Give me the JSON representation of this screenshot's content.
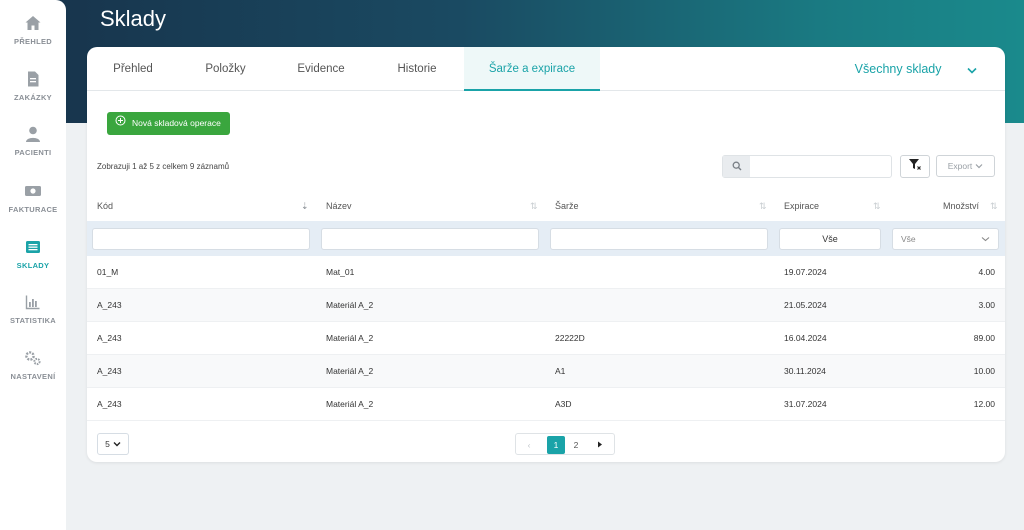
{
  "header": {
    "title": "Sklady"
  },
  "sidebar": {
    "items": [
      {
        "label": "PŘEHLED",
        "icon": "home-icon"
      },
      {
        "label": "ZAKÁZKY",
        "icon": "document-icon"
      },
      {
        "label": "PACIENTI",
        "icon": "user-icon"
      },
      {
        "label": "FAKTURACE",
        "icon": "banknote-icon"
      },
      {
        "label": "SKLADY",
        "icon": "list-icon",
        "active": true
      },
      {
        "label": "STATISTIKA",
        "icon": "chart-icon"
      },
      {
        "label": "NASTAVENÍ",
        "icon": "gears-icon"
      }
    ]
  },
  "tabs": [
    {
      "label": "Přehled"
    },
    {
      "label": "Položky"
    },
    {
      "label": "Evidence"
    },
    {
      "label": "Historie"
    },
    {
      "label": "Šarže a expirace",
      "active": true
    }
  ],
  "warehouse_select": {
    "value": "Všechny sklady"
  },
  "toolbar": {
    "new_operation_label": "Nová skladová operace",
    "export_label": "Export",
    "search_placeholder": ""
  },
  "summary_text": "Zobrazuji 1 až 5 z celkem 9 záznamů",
  "table": {
    "headers": [
      "Kód",
      "Název",
      "Šarže",
      "Expirace",
      "Množství"
    ],
    "filters": {
      "kod": "",
      "nazev": "",
      "sarze": "",
      "expirace": "Vše",
      "mnozstvi": "Vše"
    },
    "rows": [
      {
        "kod": "01_M",
        "nazev": "Mat_01",
        "sarze": "",
        "expirace": "19.07.2024",
        "mnozstvi": "4.00"
      },
      {
        "kod": "A_243",
        "nazev": "Materiál A_2",
        "sarze": "",
        "expirace": "21.05.2024",
        "mnozstvi": "3.00"
      },
      {
        "kod": "A_243",
        "nazev": "Materiál A_2",
        "sarze": "22222D",
        "expirace": "16.04.2024",
        "mnozstvi": "89.00"
      },
      {
        "kod": "A_243",
        "nazev": "Materiál A_2",
        "sarze": "A1",
        "expirace": "30.11.2024",
        "mnozstvi": "10.00"
      },
      {
        "kod": "A_243",
        "nazev": "Materiál A_2",
        "sarze": "A3D",
        "expirace": "31.07.2024",
        "mnozstvi": "12.00"
      }
    ]
  },
  "pagination": {
    "page_size": "5",
    "pages": [
      "1",
      "2"
    ],
    "current": "1"
  },
  "colors": {
    "accent": "#1aa3a8",
    "primary_button": "#3aa63e",
    "header_gradient_start": "#17324a",
    "header_gradient_end": "#1a8a8c"
  }
}
